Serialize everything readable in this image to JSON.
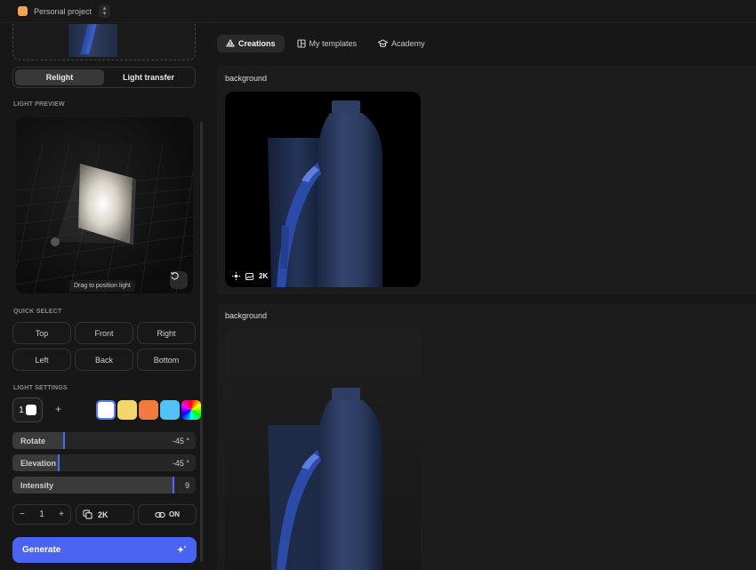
{
  "project": {
    "name": "Personal project"
  },
  "mode_toggle": {
    "relight": "Relight",
    "light_transfer": "Light transfer",
    "active": "Relight"
  },
  "light_preview": {
    "label": "LIGHT PREVIEW",
    "hint": "Drag to position light"
  },
  "quick_select": {
    "label": "QUICK SELECT",
    "buttons": [
      "Top",
      "Front",
      "Right",
      "Left",
      "Back",
      "Bottom"
    ]
  },
  "light_settings": {
    "label": "LIGHT SETTINGS",
    "count": "1",
    "add": "+",
    "colors": [
      "#ffffff",
      "#f4d66a",
      "#f27a3c",
      "#4fc3f7",
      "rainbow"
    ],
    "selected_color": "#ffffff"
  },
  "sliders": {
    "rotate": {
      "label": "Rotate",
      "value": "-45 °",
      "level": 0.28
    },
    "elevation": {
      "label": "Elevation",
      "value": "-45 °",
      "level": 0.25
    },
    "intensity": {
      "label": "Intensity",
      "value": "9",
      "level": 0.88
    }
  },
  "controls": {
    "minus": "−",
    "quantity": "1",
    "plus": "+",
    "resolution": "2K",
    "link": "ON"
  },
  "generate": {
    "label": "Generate"
  },
  "tabs": [
    {
      "label": "Creations",
      "active": true
    },
    {
      "label": "My templates",
      "active": false
    },
    {
      "label": "Academy",
      "active": false
    }
  ],
  "cards": [
    {
      "title": "background",
      "badge_resolution": "2K"
    },
    {
      "title": "background"
    }
  ],
  "colors": {
    "accent": "#4a63f0",
    "project_dot": "#f5a352"
  }
}
